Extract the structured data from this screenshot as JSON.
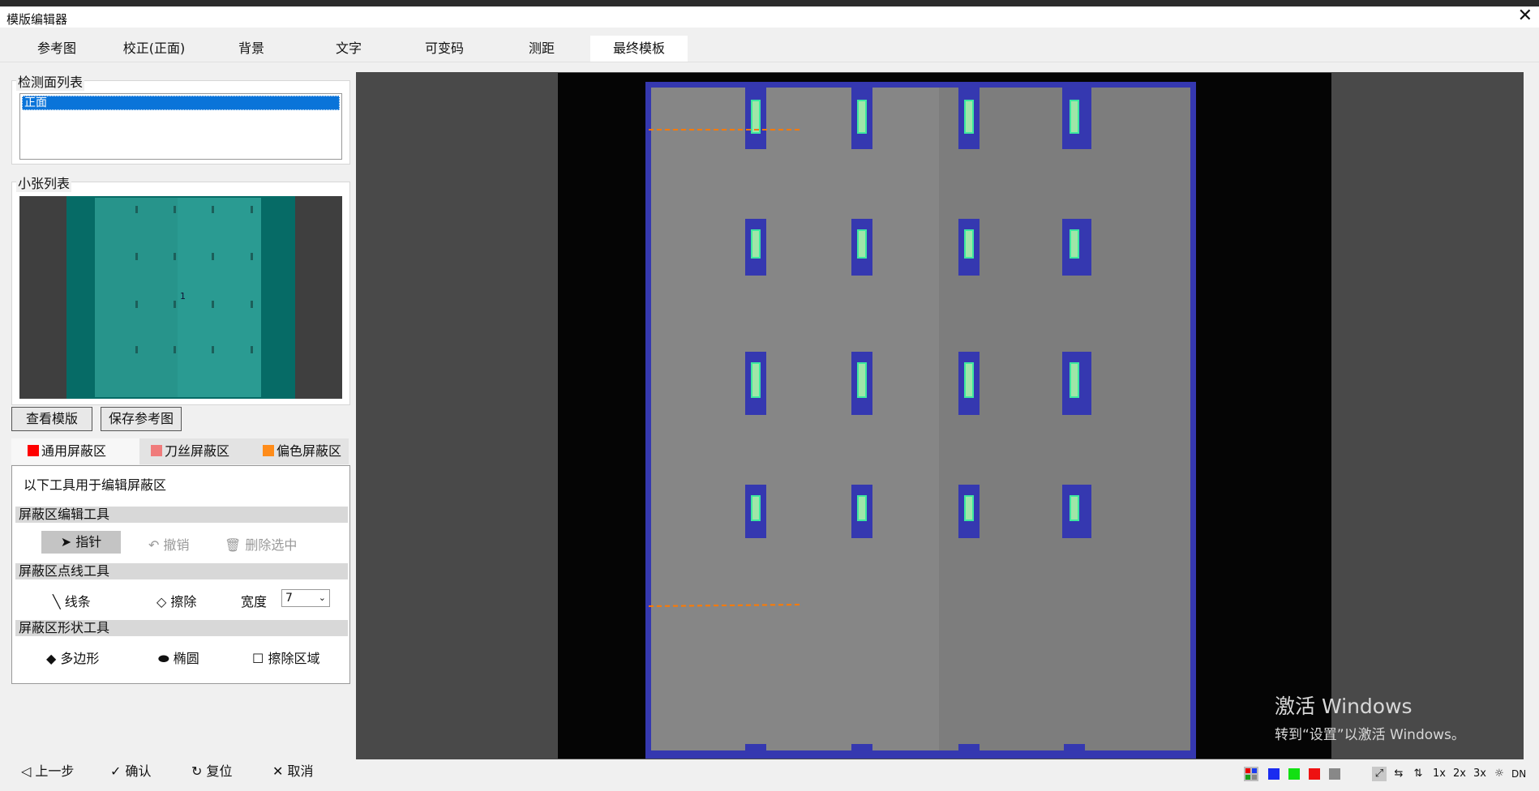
{
  "window": {
    "title": "模版编辑器",
    "close": "✕"
  },
  "tabs": [
    {
      "label": "参考图"
    },
    {
      "label": "校正(正面)"
    },
    {
      "label": "背景"
    },
    {
      "label": "文字"
    },
    {
      "label": "可变码"
    },
    {
      "label": "测距"
    },
    {
      "label": "最终模板"
    }
  ],
  "active_tab": "最终模板",
  "faces": {
    "group_label": "检测面列表",
    "items": [
      "正面"
    ]
  },
  "sheets": {
    "group_label": "小张列表",
    "thumb_marker": "1"
  },
  "buttons": {
    "view_template": "查看模版",
    "save_reference": "保存参考图"
  },
  "mask_tabs": [
    {
      "label": "通用屏蔽区",
      "color": "#ff0000"
    },
    {
      "label": "刀丝屏蔽区",
      "color": "#f07b7b"
    },
    {
      "label": "偏色屏蔽区",
      "color": "#ff8c1a"
    }
  ],
  "tools": {
    "intro": "以下工具用于编辑屏蔽区",
    "edit_section": "屏蔽区编辑工具",
    "pointer": "指针",
    "undo": "撤销",
    "delete_selected": "删除选中",
    "pointline_section": "屏蔽区点线工具",
    "line": "线条",
    "erase": "擦除",
    "width_label": "宽度",
    "width_value": "7",
    "shape_section": "屏蔽区形状工具",
    "polygon": "多边形",
    "ellipse": "椭圆",
    "erase_region": "擦除区域"
  },
  "footer": {
    "prev": "上一步",
    "confirm": "确认",
    "reset": "复位",
    "cancel": "取消"
  },
  "activation": {
    "line1": "激活 Windows",
    "line2": "转到“设置”以激活 Windows。"
  },
  "status": {
    "zoom_levels": [
      "1x",
      "2x",
      "3x"
    ],
    "dn": "DN"
  },
  "colors": {
    "accent": "#0a74d9",
    "mask_blue": "#3538b0",
    "highlight": "#3de8a0",
    "thumb_teal": "#2a9b92"
  }
}
